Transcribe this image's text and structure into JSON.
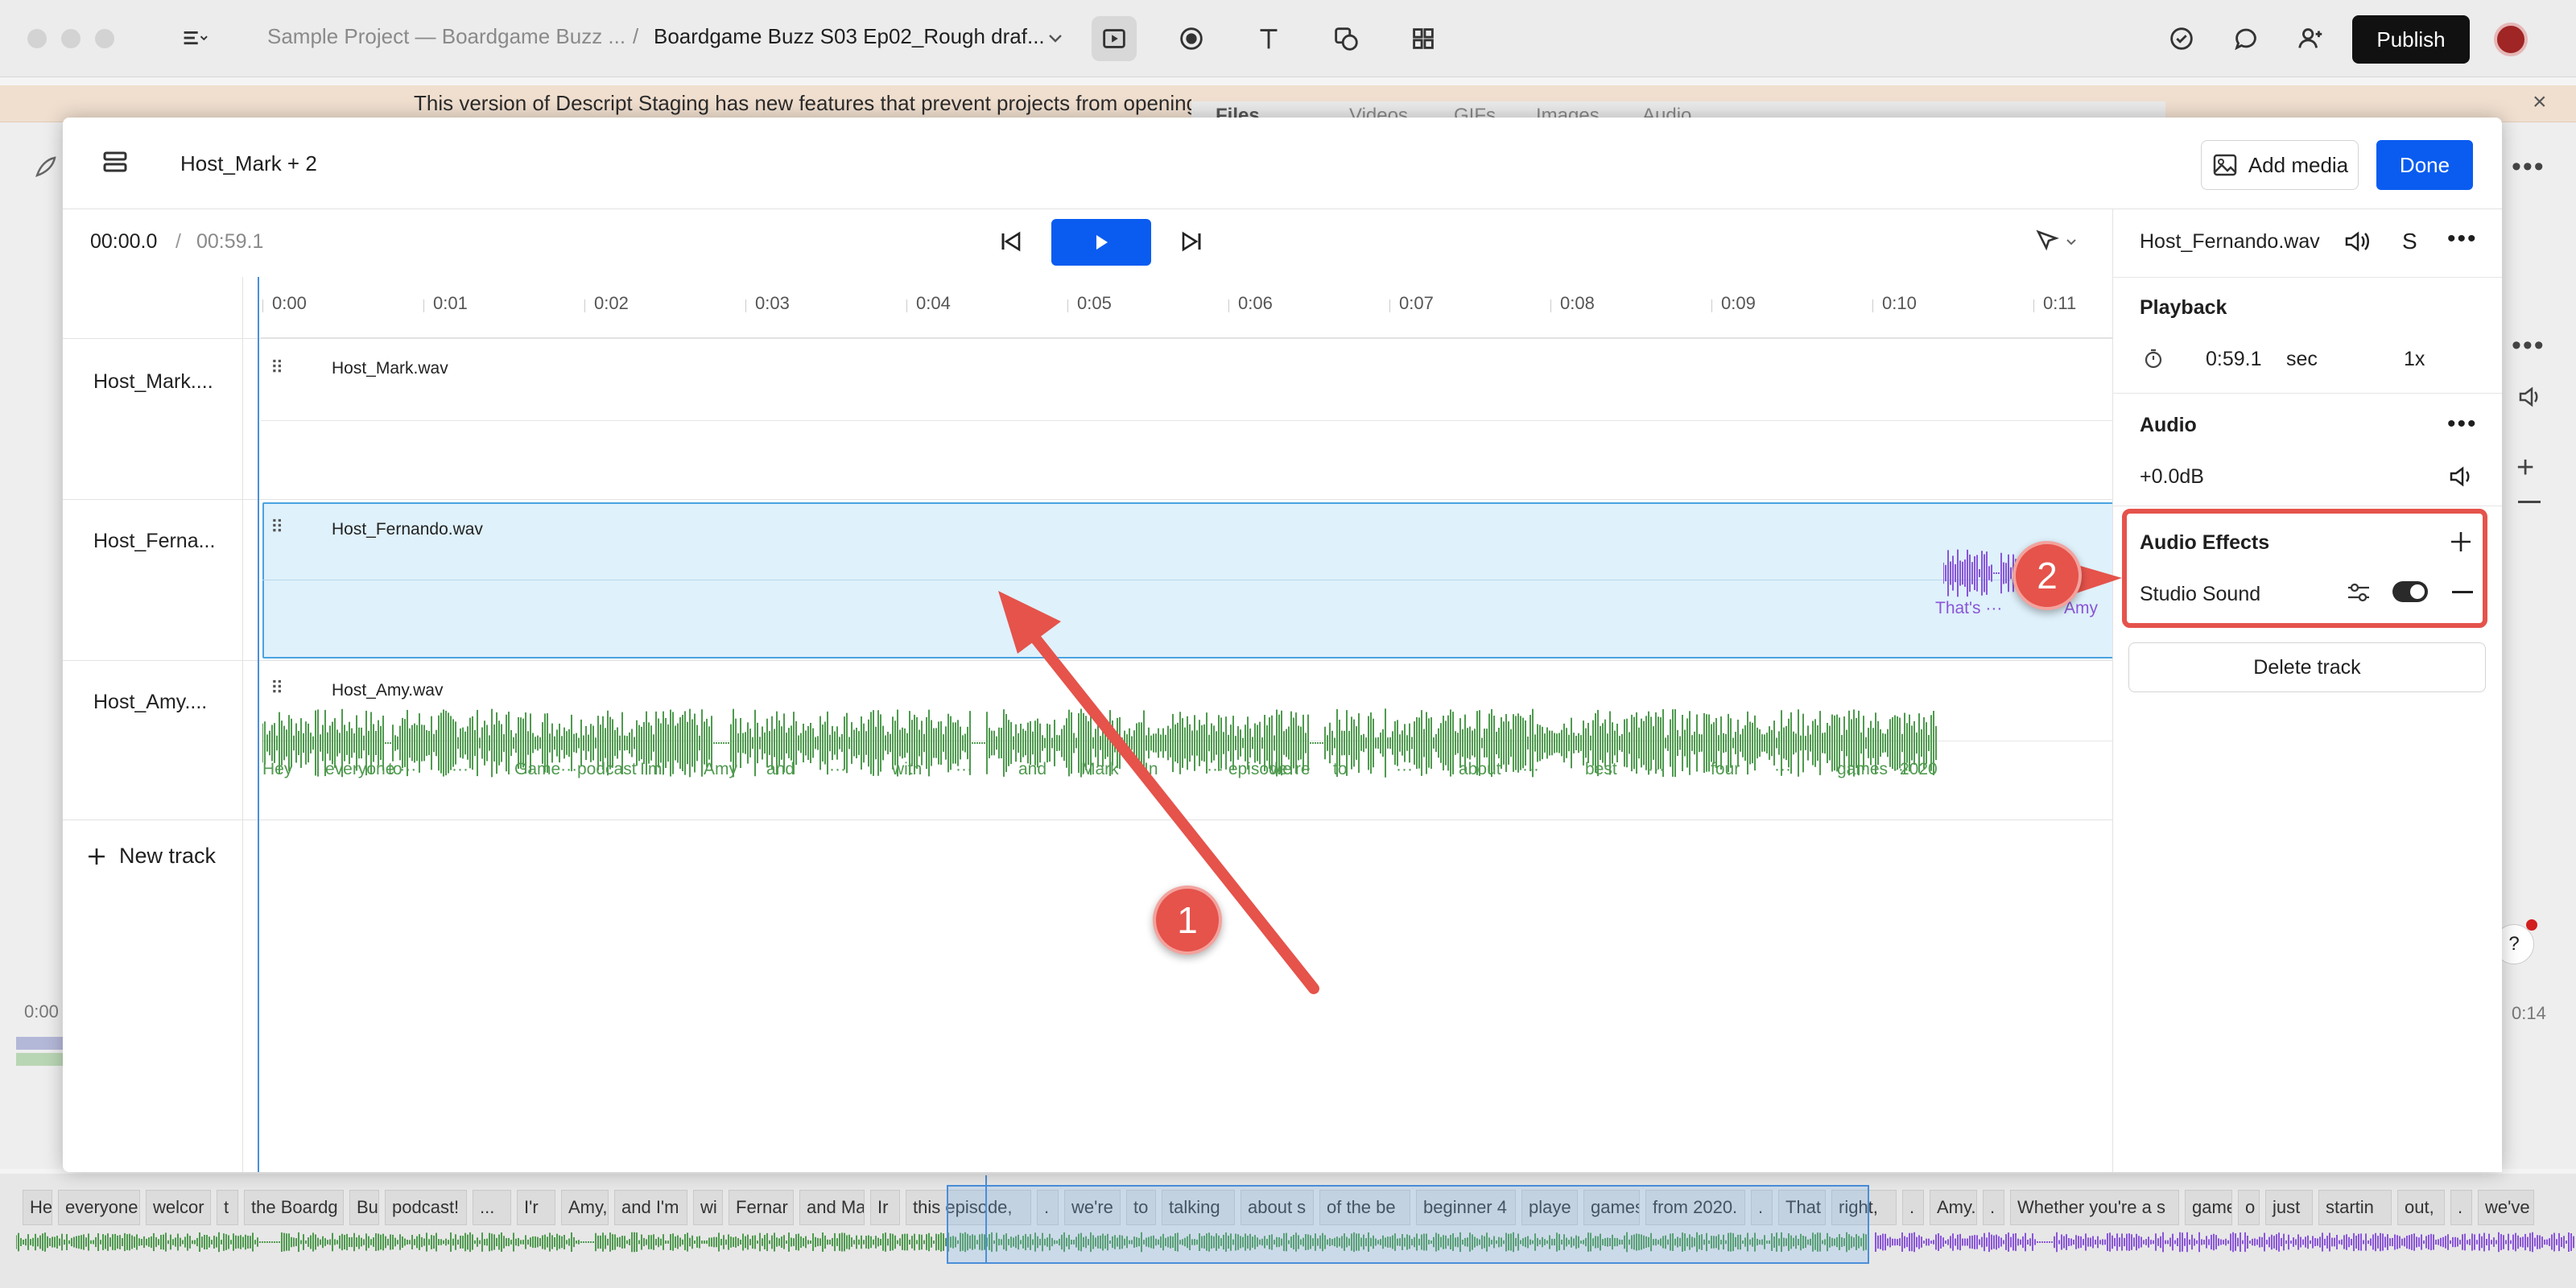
{
  "app": {
    "breadcrumb": [
      "Sample Project — Boardgame Buzz ...",
      "/",
      "Boardgame Buzz S03 Ep02_Rough draf..."
    ],
    "publish_label": "Publish",
    "notice": "This version of Descript Staging has new features that prevent projects from opening",
    "notice_close": "×",
    "bg_tabs": [
      "Files",
      "Videos",
      "GIFs",
      "Images",
      "Audio"
    ],
    "colors": {
      "accent": "#0a5cf0",
      "annotation": "#e5534b",
      "wave_green": "#4f9a4f",
      "wave_purple": "#8a55d8",
      "selected_clip": "#dff1fb"
    }
  },
  "modal": {
    "title": "Host_Mark + 2",
    "add_media_label": "Add media",
    "done_label": "Done",
    "time_current": "00:00.0",
    "time_sep": "/",
    "time_total": "00:59.1",
    "ruler_ticks": [
      "0:00",
      "0:01",
      "0:02",
      "0:03",
      "0:04",
      "0:05",
      "0:06",
      "0:07",
      "0:08",
      "0:09",
      "0:10",
      "0:11"
    ],
    "tracks": [
      {
        "label": "Host_Mark....",
        "clip": "Host_Mark.wav"
      },
      {
        "label": "Host_Ferna...",
        "clip": "Host_Fernando.wav",
        "words": [
          "That's ···",
          "Amy"
        ]
      },
      {
        "label": "Host_Amy....",
        "clip": "Host_Amy.wav",
        "words": [
          "Hey",
          "everyone ···",
          "to",
          "···",
          "Game···",
          "podcast",
          "I'm",
          "Amy",
          "and",
          "···",
          "with",
          "···",
          "and",
          "Mark",
          "In",
          "··· episode",
          "we're",
          "to",
          "···",
          "about",
          "···",
          "best",
          "···",
          "four",
          "···",
          "games ···",
          "2020"
        ]
      }
    ],
    "new_track_label": "New track"
  },
  "panel": {
    "file_name": "Host_Fernando.wav",
    "solo_label": "S",
    "playback_heading": "Playback",
    "playback_duration": "0:59.1",
    "playback_unit": "sec",
    "playback_speed": "1x",
    "audio_heading": "Audio",
    "audio_gain": "+0.0dB",
    "effects_heading": "Audio Effects",
    "effect_name": "Studio Sound",
    "effect_enabled": true,
    "delete_label": "Delete track"
  },
  "script_strip": {
    "words": [
      "He",
      "everyone",
      "welcor",
      "t",
      "the Boardg",
      "Bu",
      "podcast!",
      "...",
      "I'r",
      "Amy,",
      "and I'm",
      "wi",
      "Fernar",
      "and Ma",
      "Ir",
      "this episode,",
      ".",
      "we're",
      "to",
      "talking",
      "about s",
      "of the be",
      "beginner 4",
      "playe",
      "games",
      "from 2020.",
      ".",
      "That",
      "right,",
      ".",
      "Amy.",
      ".",
      "Whether you're a s",
      "game",
      "o",
      "just",
      "startin",
      "out,",
      ".",
      "we've"
    ]
  },
  "background": {
    "left_time": "0:00",
    "right_time": "0:14"
  },
  "annotations": [
    {
      "label": "1"
    },
    {
      "label": "2"
    }
  ]
}
